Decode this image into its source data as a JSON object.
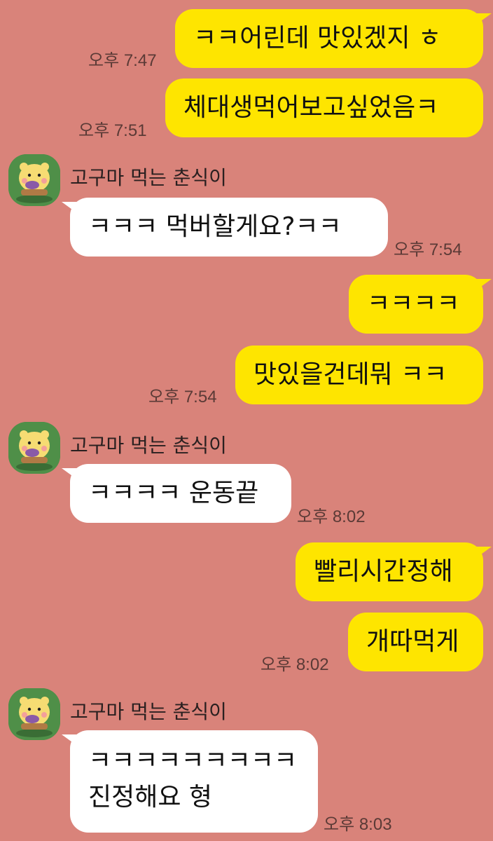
{
  "colors": {
    "background": "#d9837a",
    "my_bubble": "#fee500",
    "their_bubble": "#ffffff",
    "avatar_bg": "#4a8a4a"
  },
  "contact": {
    "name": "고구마 먹는 춘식이",
    "avatar_icon": "chunsik-eating-sweet-potato-avatar"
  },
  "messages": [
    {
      "sender": "me",
      "text": "ㅋㅋ어린데 맛있겠지 ㅎ",
      "time": "오후 7:47"
    },
    {
      "sender": "me",
      "text": "체대생먹어보고싶었음ㅋ",
      "time": "오후 7:51"
    },
    {
      "sender": "other",
      "text": "ㅋㅋㅋ 먹버할게요?ㅋㅋ",
      "time": "오후 7:54"
    },
    {
      "sender": "me",
      "text": "ㅋㅋㅋㅋ",
      "time": ""
    },
    {
      "sender": "me",
      "text": "맛있을건데뭐 ㅋㅋ",
      "time": "오후 7:54"
    },
    {
      "sender": "other",
      "text": "ㅋㅋㅋㅋ 운동끝",
      "time": "오후 8:02"
    },
    {
      "sender": "me",
      "text": "빨리시간정해",
      "time": ""
    },
    {
      "sender": "me",
      "text": "개따먹게",
      "time": "오후 8:02"
    },
    {
      "sender": "other",
      "text": "ㅋㅋㅋㅋㅋㅋㅋㅋㅋ\n진정해요 형",
      "time": "오후 8:03"
    }
  ]
}
